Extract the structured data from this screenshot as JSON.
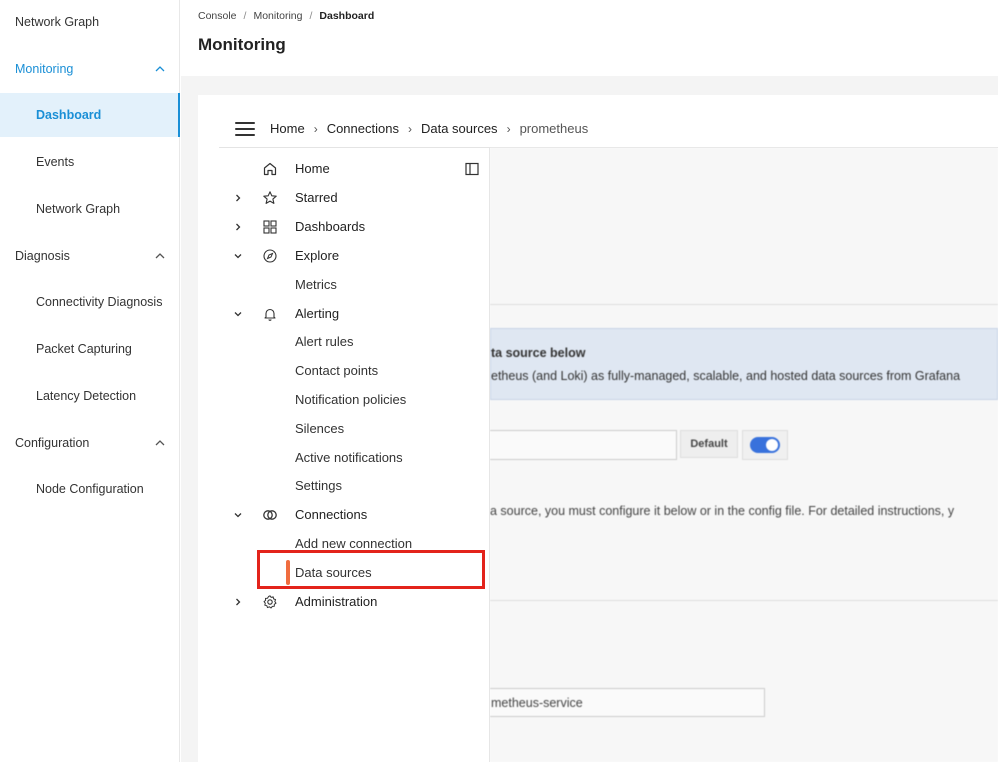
{
  "sidebar": {
    "items": [
      {
        "label": "Network Graph",
        "type": "top"
      },
      {
        "label": "Monitoring",
        "type": "group"
      },
      {
        "label": "Dashboard",
        "type": "child"
      },
      {
        "label": "Events",
        "type": "child"
      },
      {
        "label": "Network Graph",
        "type": "child"
      },
      {
        "label": "Diagnosis",
        "type": "group"
      },
      {
        "label": "Connectivity Diagnosis",
        "type": "child"
      },
      {
        "label": "Packet Capturing",
        "type": "child"
      },
      {
        "label": "Latency Detection",
        "type": "child"
      },
      {
        "label": "Configuration",
        "type": "group"
      },
      {
        "label": "Node Configuration",
        "type": "child"
      }
    ]
  },
  "header": {
    "breadcrumb": [
      "Console",
      "Monitoring",
      "Dashboard"
    ],
    "title": "Monitoring"
  },
  "grafana": {
    "breadcrumb": [
      "Home",
      "Connections",
      "Data sources",
      "prometheus"
    ],
    "menu": [
      {
        "label": "Home",
        "icon": "home-icon"
      },
      {
        "label": "Starred",
        "icon": "star-icon"
      },
      {
        "label": "Dashboards",
        "icon": "grid-icon"
      },
      {
        "label": "Explore",
        "icon": "compass-icon"
      },
      {
        "label": "Metrics"
      },
      {
        "label": "Alerting",
        "icon": "bell-icon"
      },
      {
        "label": "Alert rules"
      },
      {
        "label": "Contact points"
      },
      {
        "label": "Notification policies"
      },
      {
        "label": "Silences"
      },
      {
        "label": "Active notifications"
      },
      {
        "label": "Settings"
      },
      {
        "label": "Connections",
        "icon": "connections-icon"
      },
      {
        "label": "Add new connection"
      },
      {
        "label": "Data sources"
      },
      {
        "label": "Administration",
        "icon": "gear-icon"
      }
    ],
    "background": {
      "info_title": "ta source below",
      "info_body": "etheus (and Loki) as fully-managed, scalable, and hosted data sources from Grafana",
      "default_label": "Default",
      "config_text": "a source, you must configure it below or in the config file. For detailed instructions, y",
      "url_value": "metheus-service"
    }
  },
  "colors": {
    "accent": "#1a8fd6",
    "selection": "#f06d3f",
    "highlight_box": "#e3231b",
    "toggle": "#3871dc"
  }
}
